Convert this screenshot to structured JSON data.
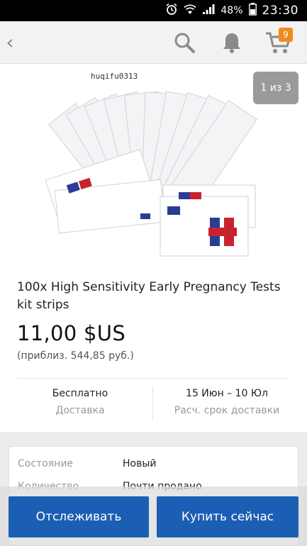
{
  "status_bar": {
    "battery_pct": "48%",
    "time": "23:30"
  },
  "app_bar": {
    "back_glyph": "‹",
    "cart_count": "9",
    "icons": [
      "search-icon",
      "bell-icon",
      "cart-icon"
    ]
  },
  "gallery": {
    "watermark": "huqifu0313",
    "counter": "1 из 3"
  },
  "product": {
    "title": "100x High Sensitivity Early Pregnancy Tests kit strips",
    "price": "11,00 $US",
    "approx_price": "(приблиз. 544,85 руб.)"
  },
  "shipping": {
    "cost": "Бесплатно",
    "cost_label": "Доставка",
    "dates": "15 Июн – 10 Юл",
    "dates_label": "Расч. срок доставки"
  },
  "specs": [
    {
      "key": "Состояние",
      "value": "Новый"
    },
    {
      "key": "Количество",
      "value": "Почти продано"
    }
  ],
  "actions": {
    "track": "Отслеживать",
    "buy": "Купить сейчас"
  },
  "colors": {
    "accent": "#1a5fb4",
    "badge": "#f08a1f"
  }
}
